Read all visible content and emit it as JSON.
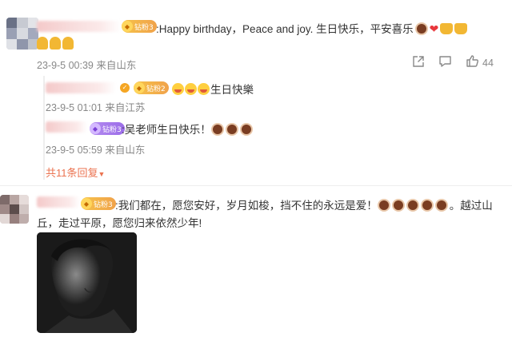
{
  "comment1": {
    "badge": "钻粉3",
    "text": ":Happy birthday，Peace and joy.   生日快乐，平安喜乐",
    "text_line2_icons": "pray-icons",
    "time": "23-9-5 00:39 来自山东",
    "like_count": "44"
  },
  "reply1": {
    "badge": "钻粉2",
    "text": "生日快樂",
    "time": "23-9-5 01:01 来自江苏"
  },
  "reply2": {
    "badge": "钻粉3",
    "text": ":吴老师生日快乐！",
    "time": "23-9-5 05:59 来自山东"
  },
  "more_replies": "共11条回复",
  "comment2": {
    "badge": "钻粉3",
    "text_line1": ":我们都在，愿您安好，岁月如梭，挡不住的永远是爱！",
    "text_line1_tail": "。越过山",
    "text_line2": "丘，走过平原，愿您归来依然少年!"
  },
  "colors": {
    "accent_link": "#eb7350",
    "meta_gray": "#888888"
  }
}
